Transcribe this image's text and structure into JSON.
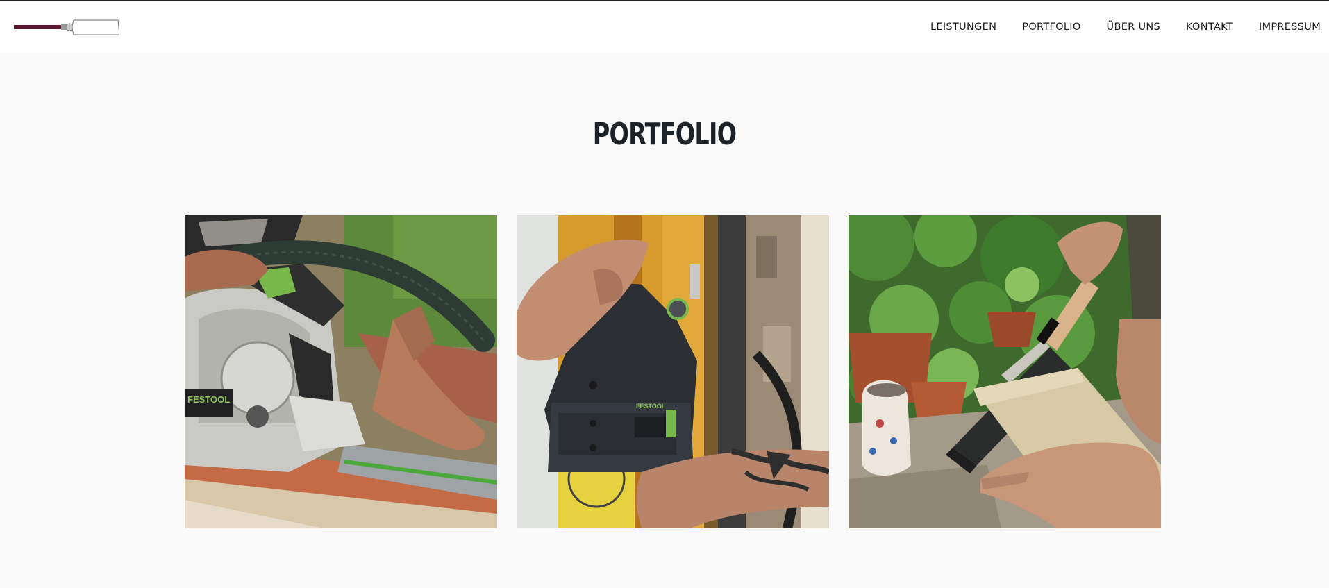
{
  "header": {
    "logo_icon": "chisel-logo-icon",
    "colors": {
      "handle": "#5c1530",
      "background": "#ffffff"
    },
    "nav": [
      {
        "label": "LEISTUNGEN"
      },
      {
        "label": "PORTFOLIO"
      },
      {
        "label": "ÜBER UNS"
      },
      {
        "label": "KONTAKT"
      },
      {
        "label": "IMPRESSUM"
      }
    ]
  },
  "section": {
    "title": "PORTFOLIO",
    "background": "#f9f9f9"
  },
  "portfolio": {
    "items": [
      {
        "icon": "circular-saw-photo",
        "brand_label": "FESTOOL"
      },
      {
        "icon": "cordless-drill-door-frame-photo",
        "brand_label": "FESTOOL"
      },
      {
        "icon": "hand-saw-garden-photo"
      }
    ]
  }
}
